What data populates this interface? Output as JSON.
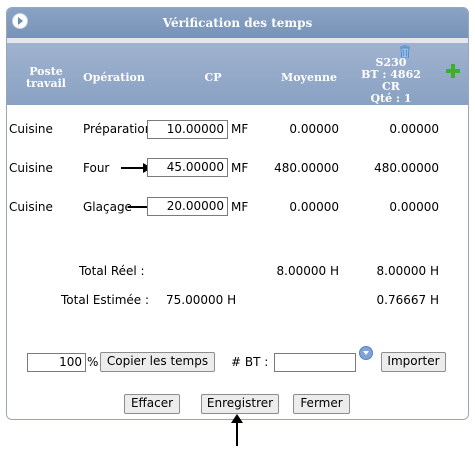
{
  "dialog": {
    "title": "Vérification des temps",
    "header": {
      "poste_travail": "Poste travail",
      "operation": "Opération",
      "cp": "CP",
      "moyenne": "Moyenne",
      "bt_code": "S230",
      "bt_number": "BT : 4862",
      "bt_status": "CR",
      "bt_qty": "Qté : 1"
    },
    "rows": [
      {
        "poste": "Cuisine",
        "operation": "Préparation",
        "cp": "10.00000",
        "unit": "MF",
        "moyenne": "0.00000",
        "bt": "0.00000"
      },
      {
        "poste": "Cuisine",
        "operation": "Four",
        "cp": "45.00000",
        "unit": "MF",
        "moyenne": "480.00000",
        "bt": "480.00000"
      },
      {
        "poste": "Cuisine",
        "operation": "Glaçage",
        "cp": "20.00000",
        "unit": "MF",
        "moyenne": "0.00000",
        "bt": "0.00000"
      }
    ],
    "totals": {
      "reel_label": "Total Réel :",
      "reel_moyenne": "8.00000 H",
      "reel_bt": "8.00000 H",
      "estimee_label": "Total Estimée :",
      "estimee_cp": "75.00000 H",
      "estimee_bt": "0.76667 H"
    },
    "controls": {
      "percent_value": "100",
      "percent_symbol": "%",
      "copy_button": "Copier les temps",
      "bt_label": "# BT :",
      "bt_input_value": "",
      "import_button": "Importer"
    },
    "footer": {
      "erase_button": "Effacer",
      "save_button": "Enregistrer",
      "close_button": "Fermer"
    }
  }
}
